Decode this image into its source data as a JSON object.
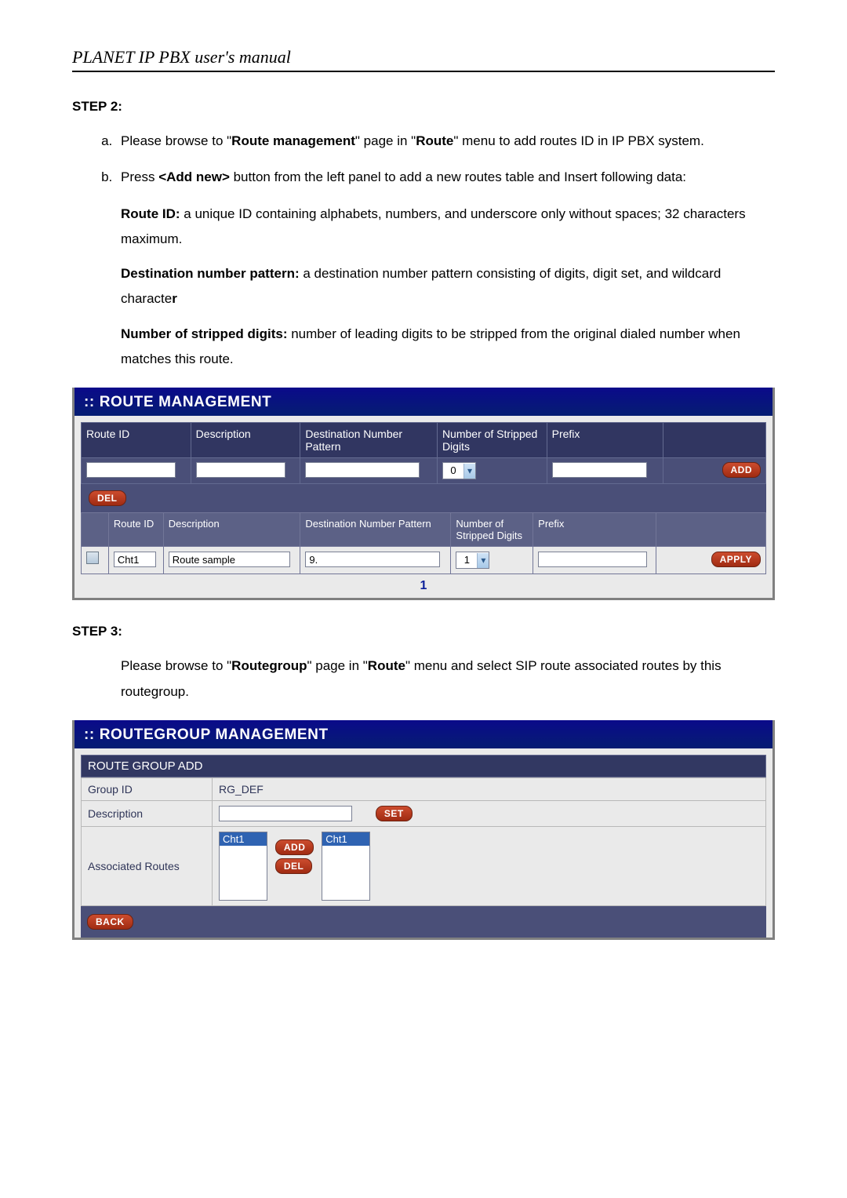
{
  "doc": {
    "title": "PLANET IP PBX user's manual",
    "step2_heading": "STEP 2:",
    "step3_heading": "STEP 3:",
    "li_a_pre": "Please browse to \"",
    "li_a_b1": "Route management",
    "li_a_mid": "\" page in \"",
    "li_a_b2": "Route",
    "li_a_post": "\" menu to add routes ID in IP PBX system.",
    "li_b_pre": "Press ",
    "li_b_b1": "<Add new>",
    "li_b_post": " button from the left panel to add a new routes table and Insert following data:",
    "p_routeid_label": "Route ID:",
    "p_routeid_text": " a unique ID containing alphabets, numbers, and underscore only without spaces; 32 characters maximum.",
    "p_dest_label": "Destination number pattern:",
    "p_dest_text": " a destination number pattern consisting of digits, digit set, and wildcard characte",
    "p_dest_bold_r": "r",
    "p_strip_label": "Number of stripped digits:",
    "p_strip_text": " number of leading digits to be stripped from the original dialed number when matches this route.",
    "step3_pre": "Please browse to \"",
    "step3_b1": "Routegroup",
    "step3_mid": "\" page in \"",
    "step3_b2": "Route",
    "step3_post": "\" menu and select SIP route associated routes by this routegroup."
  },
  "route": {
    "panel_title": ":: ROUTE MANAGEMENT",
    "hdr": {
      "route_id": "Route ID",
      "description": "Description",
      "dest": "Destination Number Pattern",
      "stripped": "Number of Stripped Digits",
      "prefix": "Prefix"
    },
    "add_select_value": "0",
    "add_btn": "ADD",
    "del_btn": "DEL",
    "data_hdr": {
      "route_id": "Route ID",
      "description": "Description",
      "dest": "Destination Number Pattern",
      "stripped": "Number of Stripped Digits",
      "prefix": "Prefix"
    },
    "row": {
      "route_id": "Cht1",
      "description": "Route sample",
      "dest": "9.",
      "stripped": "1"
    },
    "apply_btn": "APPLY",
    "pager": "1"
  },
  "rg": {
    "panel_title": ":: ROUTEGROUP MANAGEMENT",
    "section": "ROUTE GROUP ADD",
    "labels": {
      "group_id": "Group ID",
      "description": "Description",
      "assoc": "Associated Routes"
    },
    "group_id_value": "RG_DEF",
    "set_btn": "SET",
    "left_option": "Cht1",
    "right_option": "Cht1",
    "add_btn": "ADD",
    "del_btn": "DEL",
    "back_btn": "BACK"
  }
}
